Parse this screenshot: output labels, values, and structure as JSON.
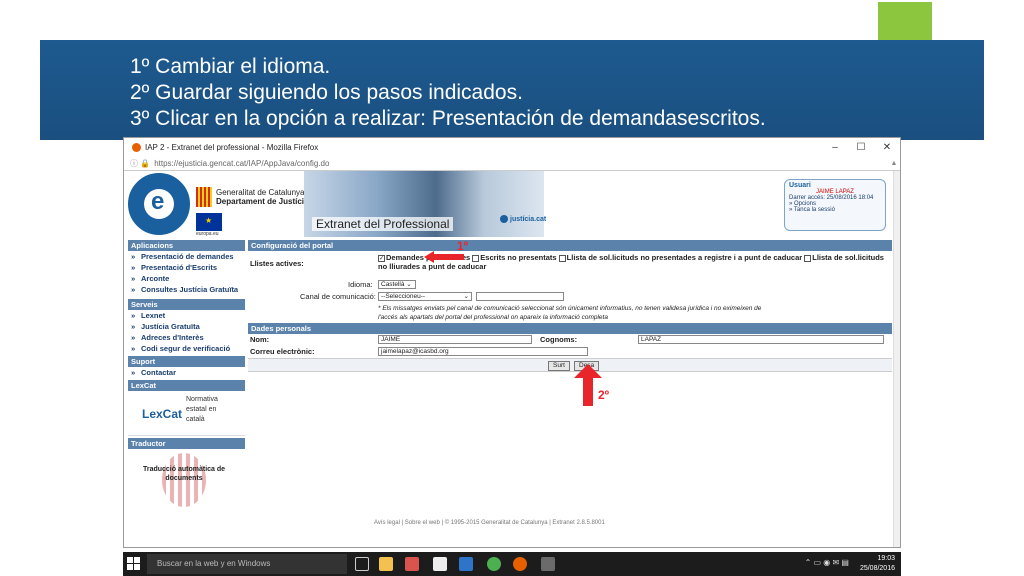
{
  "slide": {
    "instructions": [
      "1º Cambiar el idioma.",
      "2º Guardar siguiendo los pasos indicados.",
      "3º Clicar en la opción a realizar: Presentación de demandasescritos."
    ]
  },
  "browser": {
    "window_title": "IAP 2 - Extranet del professional - Mozilla Firefox",
    "url": "https://ejusticia.gencat.cat/IAP/AppJava/config.do"
  },
  "site": {
    "gen_line1": "Generalitat de Catalunya",
    "gen_line2": "Departament de Justícia",
    "eu_label": "europa.eu",
    "extranet_title": "Extranet del Professional",
    "justicia_badge": "justícia.cat",
    "user_box": {
      "heading": "Usuari",
      "name": "JAIME LAPAZ",
      "last_access": "Darrer accés: 25/08/2016 18:04",
      "options": "» Opcions",
      "logout": "» Tanca la sessió"
    }
  },
  "sidebar": {
    "sections": [
      {
        "title": "Aplicacions",
        "items": [
          "Presentació de demandes",
          "Presentació d'Escrits",
          "Arconte",
          "Consultes Justícia Gratuïta"
        ]
      },
      {
        "title": "Serveis",
        "items": [
          "Lexnet",
          "Justícia Gratuïta",
          "Adreces d'Interès",
          "Codi segur de verificació"
        ]
      },
      {
        "title": "Suport",
        "items": [
          "Contactar"
        ]
      }
    ],
    "lexcat_title": "LexCat",
    "lexcat_logo": "LexCat",
    "lexcat_desc": "Normativa estatal en català",
    "traductor_title": "Traductor",
    "traductor_text": "Traducció automàtica de documents",
    "arrow_glyph": "»"
  },
  "portal_config": {
    "heading": "Configuració del portal",
    "active_lists_label": "Llistes actives:",
    "checkbox_1": "Demandes presentades",
    "checkbox_2": "Escrits no presentats",
    "checkbox_3": "Llista de sol.licituds no presentades a registre i a punt de caducar",
    "checkbox_4": "Llista de sol.licituds no lliurades a punt de caducar",
    "language_label": "Idioma:",
    "language_value": "Castellà",
    "channel_label": "Canal de comunicació:",
    "channel_value": "--Seleccioneu--",
    "note_1": "* Els missatges enviats pel canal de comunicació seleccionat són únicament informatius, no tenen validesa jurídica i no eximeixen de",
    "note_2": "l'accés als apartats del portal del professional on apareix la informació completa"
  },
  "personal_data": {
    "heading": "Dades personals",
    "name_label": "Nom:",
    "name_value": "JAIME",
    "surname_label": "Cognoms:",
    "surname_value": "LAPAZ",
    "email_label": "Correu electrònic:",
    "email_value": "jaimelapaz@icasbd.org",
    "exit_button": "Surt",
    "save_button": "Desa"
  },
  "footer": {
    "text": "Avís legal  |  Sobre el web  |  © 1995-2015 Generalitat de Catalunya  |  Extranet 2.8.5.8001"
  },
  "annotations": {
    "step1": "1º",
    "step2": "2º",
    "arrow_color": "#e8252b"
  },
  "taskbar": {
    "search_placeholder": "Buscar en la web y en Windows",
    "time": "19:03",
    "date": "25/08/2016"
  }
}
